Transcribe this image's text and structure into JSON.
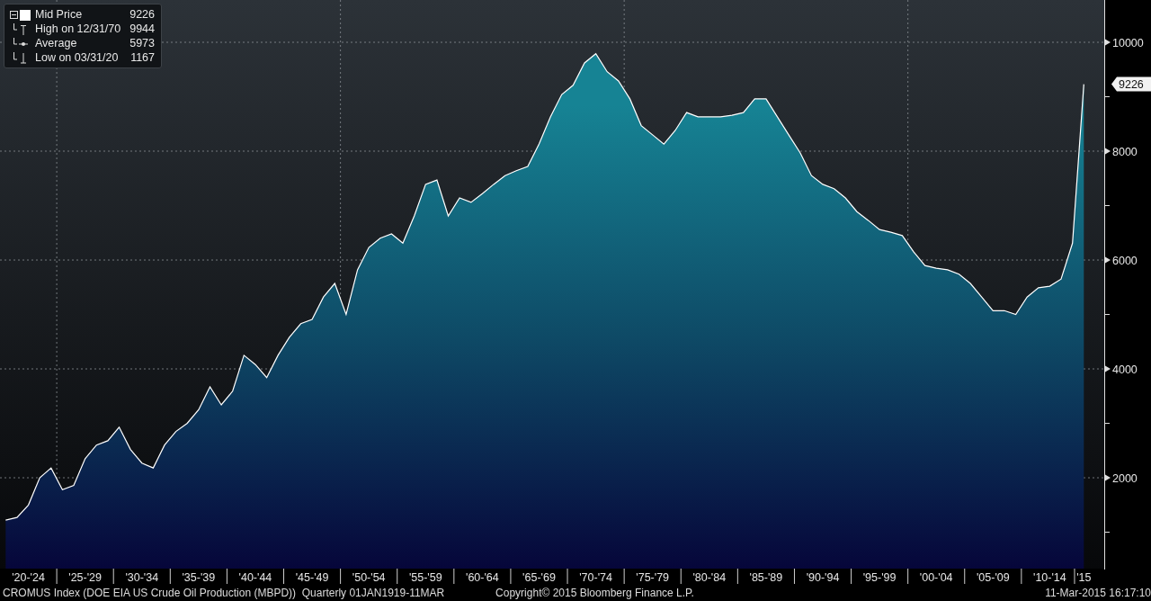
{
  "legend": {
    "items": [
      {
        "kind": "square",
        "label": "Mid Price",
        "value": "9226"
      },
      {
        "kind": "high",
        "label": "High on 12/31/70",
        "value": "9944"
      },
      {
        "kind": "average",
        "label": "Average",
        "value": "5973"
      },
      {
        "kind": "low",
        "label": "Low on 03/31/20",
        "value": "1167"
      }
    ]
  },
  "last_value_label": "9226",
  "chart": {
    "chart_data": {
      "type": "area",
      "categories": [
        null,
        null,
        "'20-'24",
        null,
        null,
        null,
        null,
        "'25-'29",
        null,
        null,
        null,
        null,
        "'30-'34",
        null,
        null,
        null,
        null,
        "'35-'39",
        null,
        null,
        null,
        null,
        "'40-'44",
        null,
        null,
        null,
        null,
        "'45-'49",
        null,
        null,
        null,
        null,
        "'50-'54",
        null,
        null,
        null,
        null,
        "'55-'59",
        null,
        null,
        null,
        null,
        "'60-'64",
        null,
        null,
        null,
        null,
        "'65-'69",
        null,
        null,
        null,
        null,
        "'70-'74",
        null,
        null,
        null,
        null,
        "'75-'79",
        null,
        null,
        null,
        null,
        "'80-'84",
        null,
        null,
        null,
        null,
        "'85-'89",
        null,
        null,
        null,
        null,
        "'90-'94",
        null,
        null,
        null,
        null,
        "'95-'99",
        null,
        null,
        null,
        null,
        "'00-'04",
        null,
        null,
        null,
        null,
        "'05-'09",
        null,
        null,
        null,
        null,
        "'10-'14",
        null,
        null,
        "'15"
      ],
      "series": [
        {
          "color": "#ffffff",
          "values": [
            1220,
            1270,
            1500,
            2000,
            2180,
            1780,
            1860,
            2350,
            2600,
            2680,
            2930,
            2520,
            2270,
            2180,
            2600,
            2850,
            3000,
            3250,
            3670,
            3340,
            3590,
            4250,
            4080,
            3840,
            4250,
            4580,
            4830,
            4910,
            5320,
            5570,
            5000,
            5820,
            6230,
            6400,
            6480,
            6310,
            6810,
            7390,
            7470,
            6810,
            7140,
            7060,
            7220,
            7390,
            7550,
            7640,
            7720,
            8130,
            8630,
            9040,
            9210,
            9620,
            9790,
            9460,
            9290,
            8960,
            8470,
            8300,
            8130,
            8380,
            8710,
            8630,
            8630,
            8630,
            8660,
            8710,
            8960,
            8960,
            8630,
            8300,
            7970,
            7550,
            7390,
            7310,
            7140,
            6890,
            6730,
            6560,
            6510,
            6450,
            6150,
            5900,
            5850,
            5820,
            5740,
            5570,
            5320,
            5070,
            5070,
            5000,
            5320,
            5490,
            5520,
            5650,
            6310,
            9230
          ]
        }
      ],
      "ylim": [
        331,
        10777
      ],
      "yticks": [
        2000,
        4000,
        6000,
        8000,
        10000
      ],
      "grid": true
    }
  },
  "footer": {
    "description": "CROMUS Index (DOE EIA US Crude Oil Production (MBPD))  Quarterly 01JAN1919-11MAR",
    "copyright": "Copyright© 2015 Bloomberg Finance L.P.",
    "timestamp": "11-Mar-2015 16:17:10"
  }
}
